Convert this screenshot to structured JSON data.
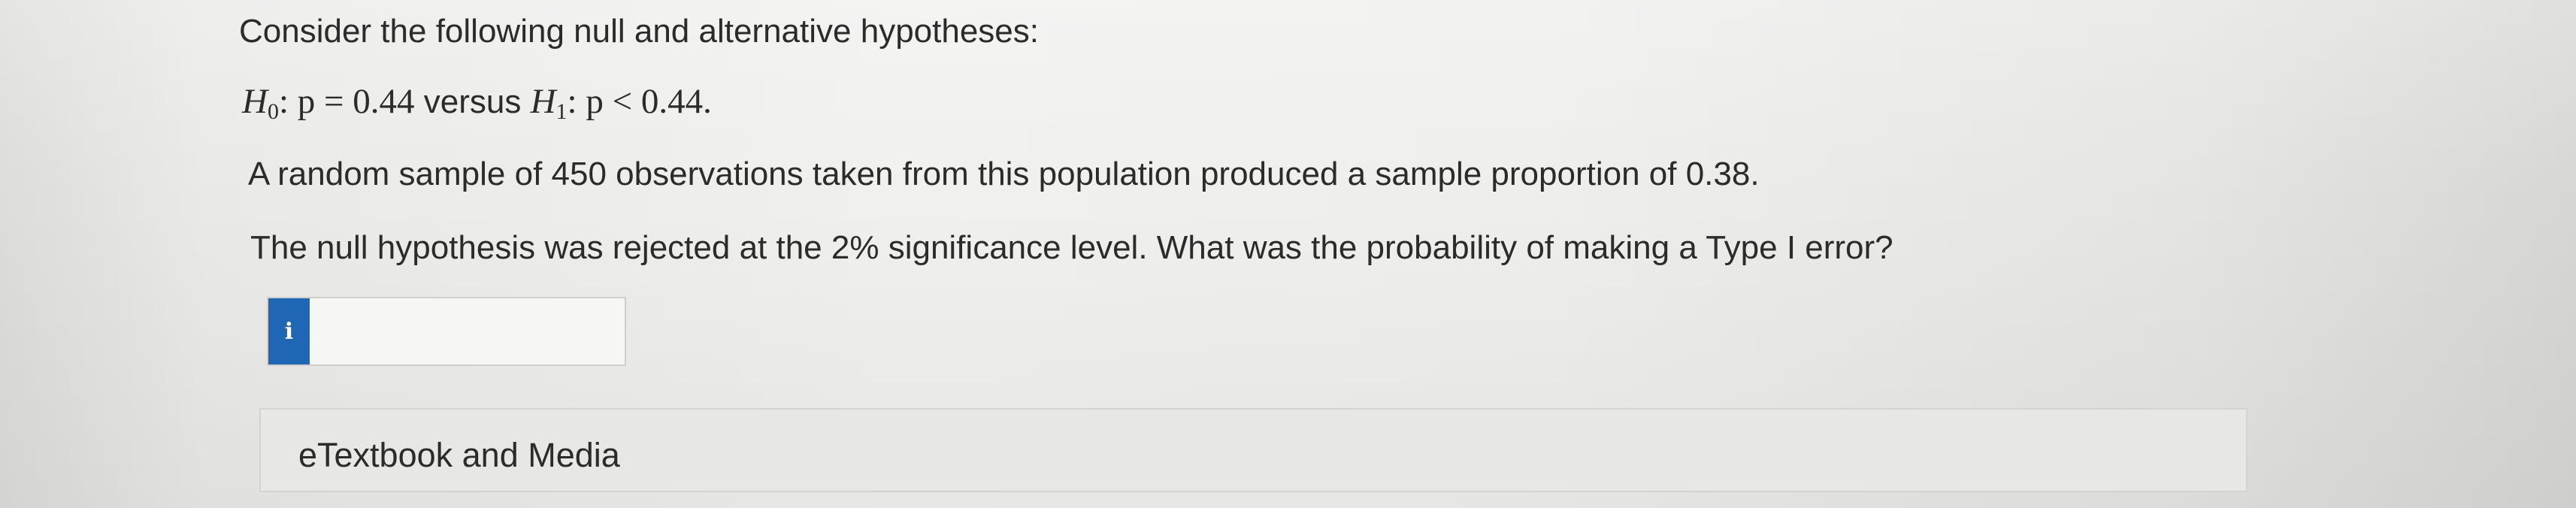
{
  "question": {
    "intro": "Consider the following null and alternative hypotheses:",
    "hypotheses": {
      "h0_symbol": "H",
      "h0_subscript": "0",
      "h0_expr": ": p = 0.44",
      "connector": "versus",
      "h1_symbol": "H",
      "h1_subscript": "1",
      "h1_expr": ": p < 0.44."
    },
    "sample_text": "A random sample of 450 observations taken from this population produced a sample proportion of 0.38.",
    "prompt_text": "The null hypothesis was rejected at the 2% significance level. What was the probability of making a Type I error?"
  },
  "answer": {
    "info_icon_glyph": "i",
    "info_icon": "info-icon",
    "value": ""
  },
  "resources": {
    "etextbook_label": "eTextbook and Media"
  },
  "colors": {
    "accent": "#1f67b5",
    "text": "#2b2b2b"
  }
}
